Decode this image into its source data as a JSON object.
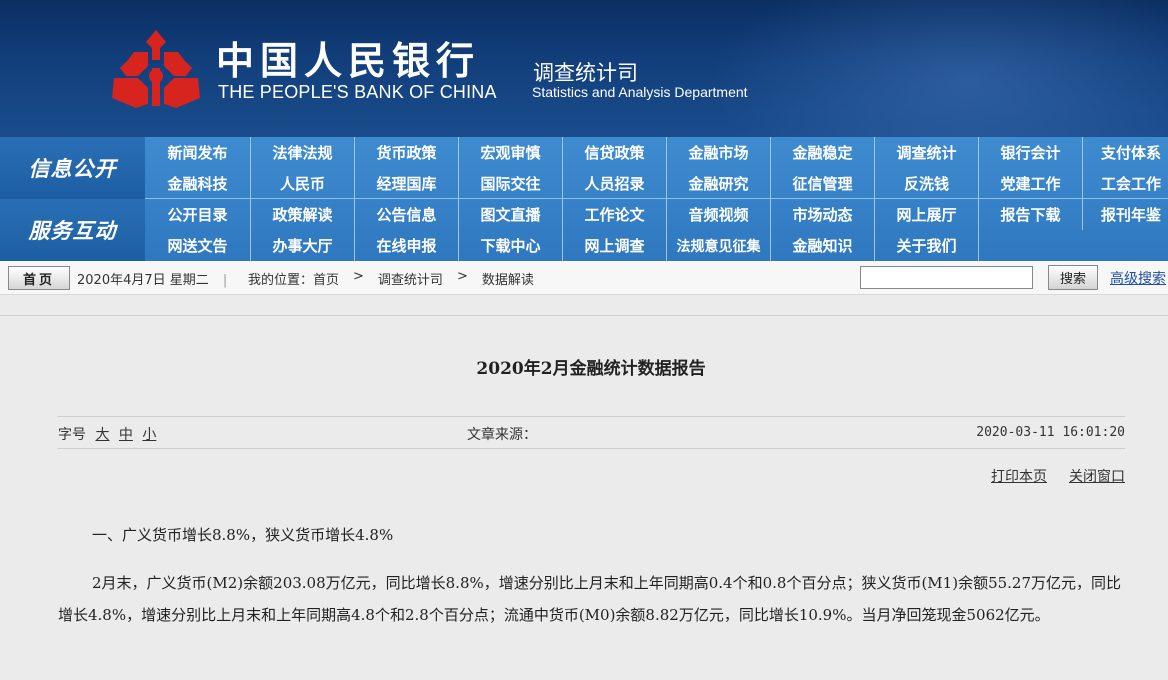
{
  "header": {
    "bank_cn": "中国人民银行",
    "bank_en": "THE PEOPLE'S BANK OF CHINA",
    "dept_cn": "调查统计司",
    "dept_en": "Statistics and Analysis Department",
    "logo_icon": "pboc-logo-icon",
    "colors": {
      "banner": "#123f7c",
      "nav": "#3583c8",
      "logo": "#d8241f"
    }
  },
  "nav": {
    "groups": [
      {
        "label": "信息公开",
        "rows": [
          [
            "新闻发布",
            "法律法规",
            "货币政策",
            "宏观审慎",
            "信贷政策",
            "金融市场",
            "金融稳定",
            "调查统计",
            "银行会计",
            "支付体系"
          ],
          [
            "金融科技",
            "人民币",
            "经理国库",
            "国际交往",
            "人员招录",
            "金融研究",
            "征信管理",
            "反洗钱",
            "党建工作",
            "工会工作"
          ]
        ]
      },
      {
        "label": "服务互动",
        "rows": [
          [
            "公开目录",
            "政策解读",
            "公告信息",
            "图文直播",
            "工作论文",
            "音频视频",
            "市场动态",
            "网上展厅",
            "报告下载",
            "报刊年鉴"
          ],
          [
            "网送文告",
            "办事大厅",
            "在线申报",
            "下载中心",
            "网上调查",
            "法规意见征集",
            "金融知识",
            "关于我们"
          ]
        ]
      }
    ]
  },
  "toolbar": {
    "home": "首页",
    "date": "2020年4月7日  星期二",
    "separator": "|",
    "breadcrumb": [
      "我的位置：首页",
      ">",
      "调查统计司",
      ">",
      "数据解读"
    ],
    "search_value": "",
    "search_button": "搜索",
    "advanced_search": "高级搜索"
  },
  "article": {
    "title": "2020年2月金融统计数据报告",
    "fontsize_label": "字号",
    "fontsize_large": "大",
    "fontsize_medium": "中",
    "fontsize_small": "小",
    "source_label": "文章来源：",
    "published": "2020-03-11 16:01:20",
    "print": "打印本页",
    "close": "关闭窗口",
    "heading1": "一、广义货币增长8.8%，狭义货币增长4.8%",
    "para1": "2月末，广义货币(M2)余额203.08万亿元，同比增长8.8%，增速分别比上月末和上年同期高0.4个和0.8个百分点；狭义货币(M1)余额55.27万亿元，同比增长4.8%，增速分别比上月末和上年同期高4.8个和2.8个百分点；流通中货币(M0)余额8.82万亿元，同比增长10.9%。当月净回笼现金5062亿元。"
  }
}
